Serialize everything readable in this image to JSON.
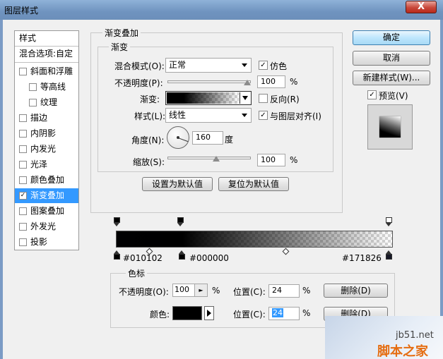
{
  "window": {
    "title": "图层样式",
    "close": "X"
  },
  "styles_list": {
    "header": "样式",
    "blend_options": "混合选项:自定",
    "items": [
      {
        "label": "斜面和浮雕",
        "checked": false
      },
      {
        "label": "等高线",
        "checked": false
      },
      {
        "label": "纹理",
        "checked": false
      },
      {
        "label": "描边",
        "checked": false
      },
      {
        "label": "内阴影",
        "checked": false
      },
      {
        "label": "内发光",
        "checked": false
      },
      {
        "label": "光泽",
        "checked": false
      },
      {
        "label": "颜色叠加",
        "checked": false
      },
      {
        "label": "渐变叠加",
        "checked": true
      },
      {
        "label": "图案叠加",
        "checked": false
      },
      {
        "label": "外发光",
        "checked": false
      },
      {
        "label": "投影",
        "checked": false
      }
    ]
  },
  "gradient_overlay": {
    "title": "渐变叠加",
    "subtitle": "渐变",
    "blend_mode_label": "混合模式(O):",
    "blend_mode_value": "正常",
    "dither_label": "仿色",
    "dither_checked": true,
    "opacity_label": "不透明度(P):",
    "opacity_value": "100",
    "opacity_unit": "%",
    "gradient_label": "渐变:",
    "reverse_label": "反向(R)",
    "reverse_checked": false,
    "style_label": "样式(L):",
    "style_value": "线性",
    "align_label": "与图层对齐(I)",
    "align_checked": true,
    "angle_label": "角度(N):",
    "angle_value": "160",
    "angle_unit": "度",
    "scale_label": "缩放(S):",
    "scale_value": "100",
    "scale_unit": "%",
    "make_default": "设置为默认值",
    "reset_default": "复位为默认值"
  },
  "right_panel": {
    "ok": "确定",
    "cancel": "取消",
    "new_style": "新建样式(W)...",
    "preview_label": "预览(V)",
    "preview_checked": true
  },
  "gradient_editor": {
    "stop_labels": [
      "#010102",
      "#000000",
      "#171826"
    ],
    "color_stop_group": "色标",
    "opacity_label": "不透明度(O):",
    "opacity_value": "100",
    "opacity_unit": "%",
    "location_label": "位置(C):",
    "location_value": "24",
    "location_unit": "%",
    "delete_label": "删除(D)",
    "color_label": "颜色:",
    "color_location_value": "24",
    "color_hex": "#000000",
    "delete_label2": "删除(D)"
  },
  "watermark": {
    "line1": "jb51.net",
    "line2": "脚本之家"
  },
  "colors": {
    "title_bar": "#7b9bc5",
    "selected": "#3399ff",
    "ok_button": "#bee6fd"
  }
}
